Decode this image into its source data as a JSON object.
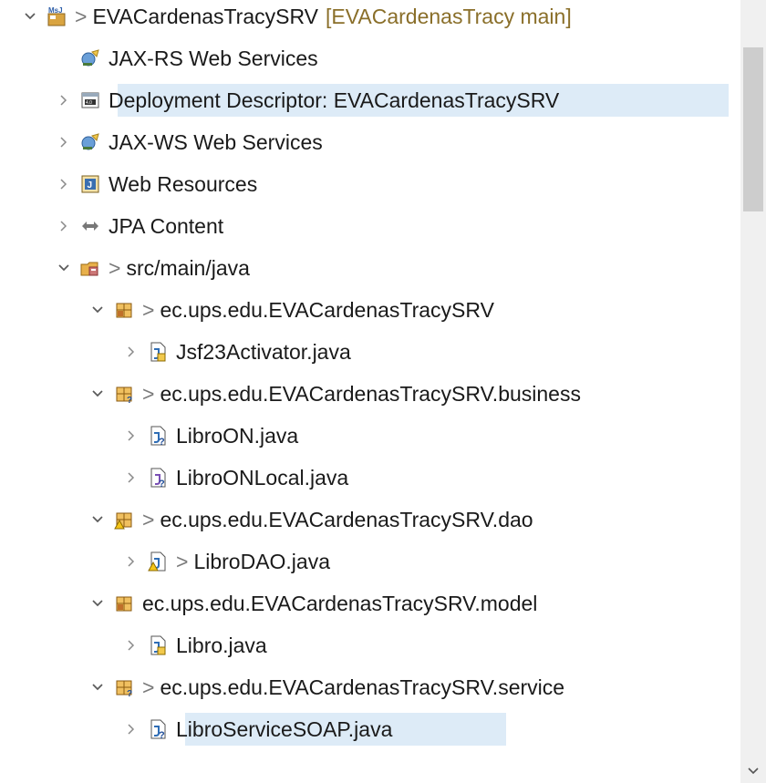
{
  "tree": {
    "rows": [
      {
        "name": "project-evacardenastracysrv",
        "indent": 0,
        "toggle": "expanded",
        "icon": "project-icon",
        "prefix": ">",
        "label": "EVACardenasTracySRV",
        "decoration": "[EVACardenasTracy main]"
      },
      {
        "name": "jax-rs-web-services",
        "indent": 1,
        "toggle": "none",
        "icon": "jax-rs-icon",
        "label": "JAX-RS Web Services"
      },
      {
        "name": "deployment-descriptor",
        "indent": 1,
        "toggle": "collapsed",
        "icon": "deployment-descriptor-icon",
        "label": "Deployment Descriptor: EVACardenasTracySRV",
        "selected": true
      },
      {
        "name": "jax-ws-web-services",
        "indent": 1,
        "toggle": "collapsed",
        "icon": "jax-ws-icon",
        "label": "JAX-WS Web Services"
      },
      {
        "name": "web-resources",
        "indent": 1,
        "toggle": "collapsed",
        "icon": "web-resources-icon",
        "label": "Web Resources"
      },
      {
        "name": "jpa-content",
        "indent": 1,
        "toggle": "collapsed",
        "icon": "jpa-icon",
        "label": "JPA Content"
      },
      {
        "name": "src-main-java",
        "indent": 1,
        "toggle": "expanded",
        "icon": "source-folder-icon",
        "prefix": ">",
        "label": "src/main/java"
      },
      {
        "name": "pkg-root",
        "indent": 2,
        "toggle": "expanded",
        "icon": "package-icon",
        "prefix": ">",
        "label": "ec.ups.edu.EVACardenasTracySRV"
      },
      {
        "name": "file-jsf23activator",
        "indent": 3,
        "toggle": "collapsed",
        "icon": "java-file-icon",
        "label": "Jsf23Activator.java"
      },
      {
        "name": "pkg-business",
        "indent": 2,
        "toggle": "expanded",
        "icon": "package-changed-icon",
        "prefix": ">",
        "label": "ec.ups.edu.EVACardenasTracySRV.business"
      },
      {
        "name": "file-libroon",
        "indent": 3,
        "toggle": "collapsed",
        "icon": "java-file-changed-icon",
        "label": "LibroON.java"
      },
      {
        "name": "file-libroonlocal",
        "indent": 3,
        "toggle": "collapsed",
        "icon": "java-interface-icon",
        "label": "LibroONLocal.java"
      },
      {
        "name": "pkg-dao",
        "indent": 2,
        "toggle": "expanded",
        "icon": "package-warning-icon",
        "prefix": ">",
        "label": "ec.ups.edu.EVACardenasTracySRV.dao"
      },
      {
        "name": "file-librodao",
        "indent": 3,
        "toggle": "collapsed",
        "icon": "java-file-warning-icon",
        "prefix": ">",
        "label": "LibroDAO.java"
      },
      {
        "name": "pkg-model",
        "indent": 2,
        "toggle": "expanded",
        "icon": "package-icon",
        "label": "ec.ups.edu.EVACardenasTracySRV.model"
      },
      {
        "name": "file-libro",
        "indent": 3,
        "toggle": "collapsed",
        "icon": "java-file-icon",
        "label": "Libro.java"
      },
      {
        "name": "pkg-service",
        "indent": 2,
        "toggle": "expanded",
        "icon": "package-changed-icon",
        "prefix": ">",
        "label": "ec.ups.edu.EVACardenasTracySRV.service"
      },
      {
        "name": "file-libroservicesoap",
        "indent": 3,
        "toggle": "collapsed",
        "icon": "java-file-changed-icon",
        "label": "LibroServiceSOAP.java",
        "selected": true
      }
    ]
  },
  "scrollbar": {
    "down_icon": "chevron-down-icon"
  }
}
